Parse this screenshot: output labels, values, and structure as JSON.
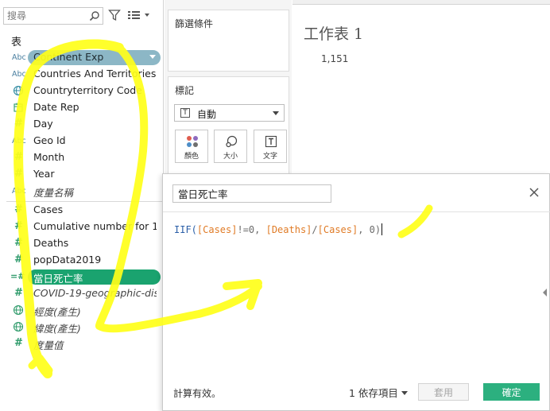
{
  "search": {
    "placeholder": "搜尋"
  },
  "data_pane": {
    "section_title": "表",
    "fields": [
      {
        "label": "Continent Exp",
        "type": "abc",
        "highlight": "dimension"
      },
      {
        "label": "Countries And Territories",
        "type": "abc"
      },
      {
        "label": "Countryterritory Code",
        "type": "globe"
      },
      {
        "label": "Date Rep",
        "type": "calendar"
      },
      {
        "label": "Day",
        "type": "number"
      },
      {
        "label": "Geo Id",
        "type": "abc"
      },
      {
        "label": "Month",
        "type": "number"
      },
      {
        "label": "Year",
        "type": "number"
      },
      {
        "label": "度量名稱",
        "type": "abc",
        "italic": true
      },
      {
        "label": "Cases",
        "type": "number"
      },
      {
        "label": "Cumulative number for 1...",
        "type": "number"
      },
      {
        "label": "Deaths",
        "type": "number"
      },
      {
        "label": "popData2019",
        "type": "number"
      },
      {
        "label": "當日死亡率",
        "type": "calc-number",
        "highlight": "measure"
      },
      {
        "label": "COVID-19-geographic-dis...",
        "type": "number",
        "italic": true
      },
      {
        "label": "經度(產生)",
        "type": "globe",
        "italic": true
      },
      {
        "label": "緯度(產生)",
        "type": "globe",
        "italic": true
      },
      {
        "label": "度量值",
        "type": "number",
        "italic": true
      }
    ]
  },
  "shelves": {
    "filters_title": "篩選條件",
    "marks_title": "標記",
    "mark_type": "自動",
    "mark_buttons": [
      {
        "label": "顏色",
        "icon": "color-dots-icon"
      },
      {
        "label": "大小",
        "icon": "size-icon"
      },
      {
        "label": "文字",
        "icon": "text-icon"
      }
    ]
  },
  "worksheet": {
    "title": "工作表 1",
    "value": "1,151"
  },
  "calc_dialog": {
    "name": "當日死亡率",
    "formula": {
      "func": "IIF(",
      "f1": "[Cases]",
      "t1": "!=0, ",
      "f2": "[Deaths]",
      "t2": "/",
      "f3": "[Cases]",
      "t3": ", 0)"
    },
    "status": "計算有效。",
    "dependencies": "1 依存項目",
    "apply_label": "套用",
    "ok_label": "確定"
  },
  "colors": {
    "dimension_pill": "#8cb7c6",
    "measure_pill": "#1aa36f",
    "ok_button": "#2cb07f",
    "annotation": "#ffff1a"
  }
}
